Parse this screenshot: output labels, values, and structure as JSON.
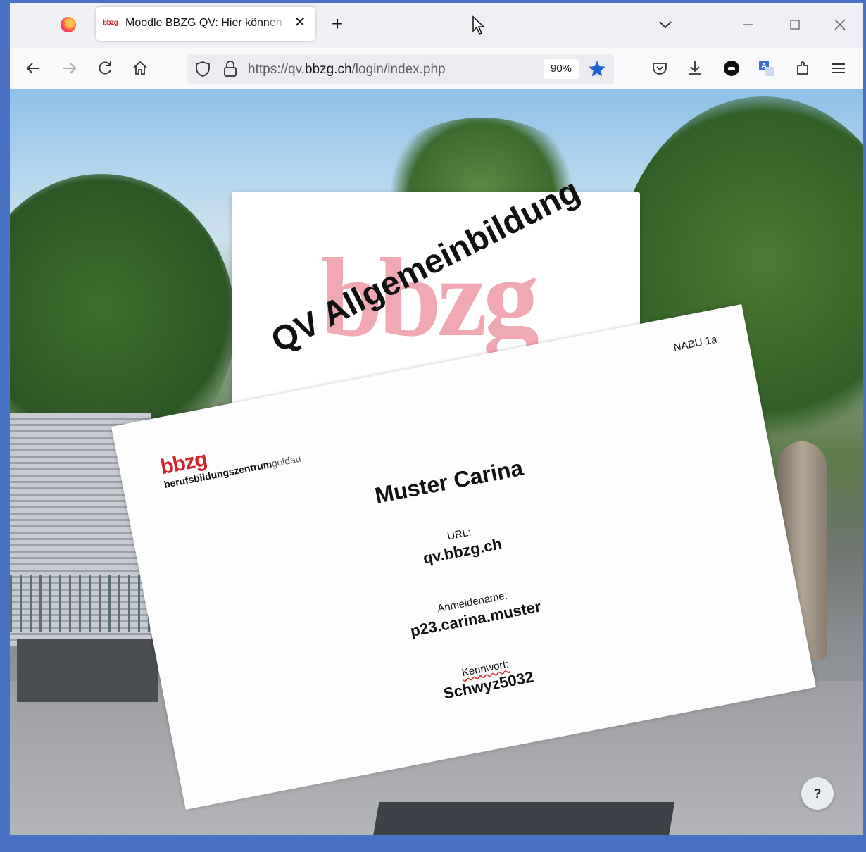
{
  "browser": {
    "tab": {
      "favicon_text": "bbzg",
      "title": "Moodle BBZG QV: Hier können",
      "close_glyph": "✕"
    },
    "newtab_glyph": "+",
    "url": {
      "prefix": "https://qv.",
      "domain": "bbzg.ch",
      "path": "/login/index.php"
    },
    "zoom": "90%"
  },
  "page": {
    "logo_text": "bbzg",
    "logo_overlay": "QV Allgemeinbildung",
    "help_label": "?"
  },
  "paper": {
    "class": "NABU 1a",
    "logo_mark": "bbzg",
    "logo_sub_a": "berufsbildungs",
    "logo_sub_b": "zentrum",
    "logo_sub_c": "goldau",
    "name": "Muster Carina",
    "url_label": "URL:",
    "url_value": "qv.bbzg.ch",
    "user_label": "Anmeldename:",
    "user_value": "p23.carina.muster",
    "pass_label": "Kennwort:",
    "pass_value": "Schwyz5032"
  }
}
